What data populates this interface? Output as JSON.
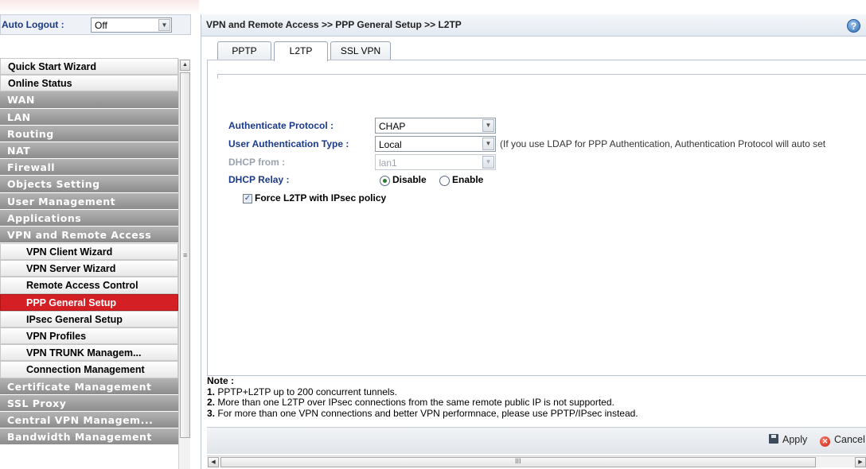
{
  "auto_logout": {
    "label": "Auto Logout :",
    "value": "Off"
  },
  "menu": [
    {
      "label": "Quick Start Wizard",
      "kind": "light"
    },
    {
      "label": "Online Status",
      "kind": "light"
    },
    {
      "label": "WAN",
      "kind": "dark"
    },
    {
      "label": "LAN",
      "kind": "dark"
    },
    {
      "label": "Routing",
      "kind": "dark"
    },
    {
      "label": "NAT",
      "kind": "dark"
    },
    {
      "label": "Firewall",
      "kind": "dark"
    },
    {
      "label": "Objects Setting",
      "kind": "dark"
    },
    {
      "label": "User Management",
      "kind": "dark"
    },
    {
      "label": "Applications",
      "kind": "dark"
    },
    {
      "label": "VPN and Remote Access",
      "kind": "dark"
    },
    {
      "label": "VPN Client Wizard",
      "kind": "sub"
    },
    {
      "label": "VPN Server Wizard",
      "kind": "sub"
    },
    {
      "label": "Remote Access Control",
      "kind": "sub"
    },
    {
      "label": "PPP General Setup",
      "kind": "active"
    },
    {
      "label": "IPsec General Setup",
      "kind": "sub"
    },
    {
      "label": "VPN Profiles",
      "kind": "sub"
    },
    {
      "label": "VPN TRUNK Managem...",
      "kind": "sub"
    },
    {
      "label": "Connection Management",
      "kind": "sub"
    },
    {
      "label": "Certificate Management",
      "kind": "dark"
    },
    {
      "label": "SSL Proxy",
      "kind": "dark"
    },
    {
      "label": "Central VPN Managem...",
      "kind": "dark"
    },
    {
      "label": "Bandwidth Management",
      "kind": "dark"
    }
  ],
  "breadcrumb": "VPN and Remote Access >> PPP General Setup >> L2TP",
  "help_icon": "?",
  "tabs": [
    "PPTP",
    "L2TP",
    "SSL VPN"
  ],
  "selected_tab": "L2TP",
  "form": {
    "auth_protocol_label": "Authenticate Protocol :",
    "auth_protocol_value": "CHAP",
    "user_auth_type_label": "User Authentication Type :",
    "user_auth_type_value": "Local",
    "user_auth_hint": "(If you use LDAP for PPP Authentication, Authentication Protocol will auto set",
    "dhcp_from_label": "DHCP from :",
    "dhcp_from_value": "lan1",
    "dhcp_relay_label": "DHCP Relay :",
    "dhcp_relay_options": [
      "Disable",
      "Enable"
    ],
    "dhcp_relay_selected": "Disable",
    "force_l2tp_label": "Force L2TP with IPsec policy",
    "force_l2tp_checked": true
  },
  "notes": {
    "title": "Note :",
    "items": [
      {
        "num": "1.",
        "text": " PPTP+L2TP up to 200 concurrent tunnels."
      },
      {
        "num": "2.",
        "text": " More than one L2TP over IPsec connections from the same remote public IP is not supported."
      },
      {
        "num": "3.",
        "text": " For more than one VPN connections and better VPN performnace, please use PPTP/IPsec instead."
      }
    ]
  },
  "actions": {
    "apply": "Apply",
    "cancel": "Cancel"
  },
  "icons": {
    "scroll_grip": "≡",
    "hscroll_grip": "III"
  },
  "colors": {
    "active_menu": "#d42024",
    "label_blue": "#1a3a8a"
  }
}
